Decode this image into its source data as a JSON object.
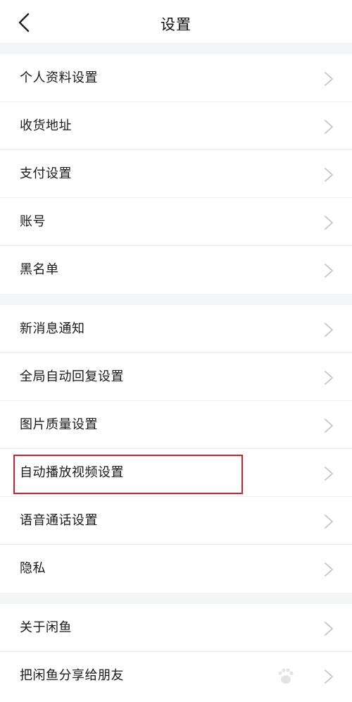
{
  "header": {
    "title": "设置",
    "back_icon": "chevron-left-icon"
  },
  "groups": [
    {
      "items": [
        {
          "label": "个人资料设置"
        },
        {
          "label": "收货地址"
        },
        {
          "label": "支付设置"
        },
        {
          "label": "账号"
        },
        {
          "label": "黑名单"
        }
      ]
    },
    {
      "items": [
        {
          "label": "新消息通知"
        },
        {
          "label": "全局自动回复设置"
        },
        {
          "label": "图片质量设置"
        },
        {
          "label": "自动播放视频设置",
          "highlighted": true
        },
        {
          "label": "语音通话设置"
        },
        {
          "label": "隐私"
        }
      ]
    },
    {
      "items": [
        {
          "label": "关于闲鱼"
        },
        {
          "label": "把闲鱼分享给朋友"
        }
      ]
    }
  ],
  "icons": {
    "row_chevron": "chevron-right-icon"
  },
  "colors": {
    "highlight": "#c8232c",
    "gap": "#f4f5f7",
    "chevron": "#c4c4c4"
  }
}
